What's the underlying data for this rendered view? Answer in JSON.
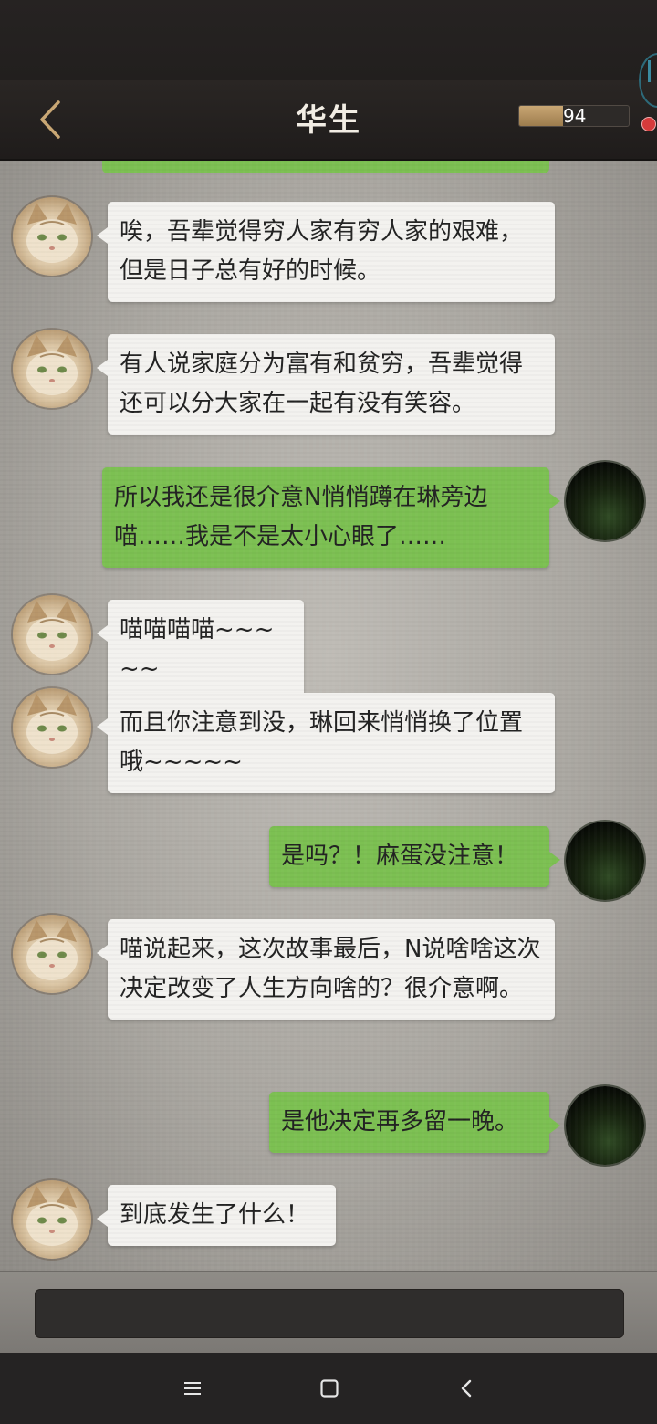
{
  "header": {
    "title": "华生",
    "meter_value": "94",
    "meter_fill_fraction": 0.4
  },
  "messages": [
    {
      "side": "left",
      "text": "唉，吾辈觉得穷人家有穷人家的艰难，但是日子总有好的时候。"
    },
    {
      "side": "left",
      "text": "有人说家庭分为富有和贫穷，吾辈觉得还可以分大家在一起有没有笑容。"
    },
    {
      "side": "right",
      "text": "所以我还是很介意N悄悄蹲在琳旁边喵……我是不是太小心眼了……"
    },
    {
      "side": "left",
      "text": "喵喵喵喵~~~~~"
    },
    {
      "side": "left",
      "text": "而且你注意到没，琳回来悄悄换了位置哦~~~~~"
    },
    {
      "side": "right",
      "text": "是吗？！麻蛋没注意！"
    },
    {
      "side": "left",
      "text": "喵说起来，这次故事最后，N说啥啥这次决定改变了人生方向啥的？很介意啊。"
    },
    {
      "side": "right",
      "text": "是他决定再多留一晚。"
    },
    {
      "side": "left",
      "text": "到底发生了什么！"
    }
  ],
  "input": {
    "placeholder": ""
  },
  "colors": {
    "bubble_right": "#7cc052",
    "bubble_left": "#f3f2ef",
    "accent_back": "#c9a774"
  },
  "icons": {
    "back": "back-chevron-icon",
    "nav_menu": "menu-icon",
    "nav_home": "home-square-icon",
    "nav_back": "back-triangle-icon"
  }
}
